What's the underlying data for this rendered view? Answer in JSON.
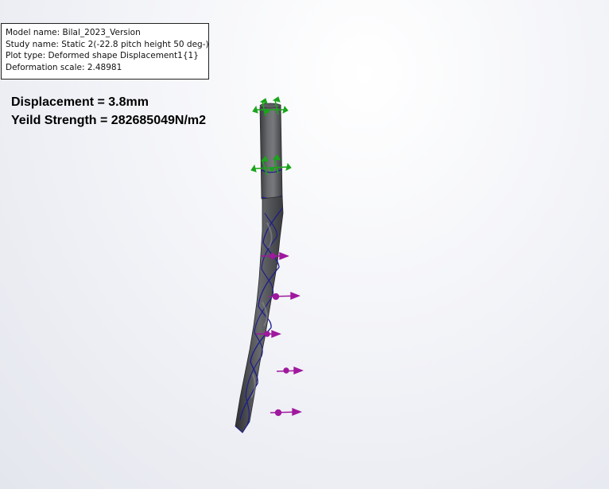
{
  "info_box": {
    "model_name": "Model name: Bilal_2023_Version",
    "study_name": "Study name: Static 2(-22.8 pitch height 50 deg-)",
    "plot_type": "Plot type: Deformed shape Displacement1{1}",
    "deformation_scale": "Deformation scale: 2.48981"
  },
  "annotations": {
    "displacement": "Displacement = 3.8mm",
    "yield_strength": "Yeild Strength = 282685049N/m2"
  },
  "colors": {
    "fixture": "#1aa51a",
    "load": "#a0189e",
    "edge": "#1c1c8c",
    "shank": "#55575a"
  },
  "icons": [
    "fixture-arrows-icon",
    "load-arrows-icon"
  ]
}
